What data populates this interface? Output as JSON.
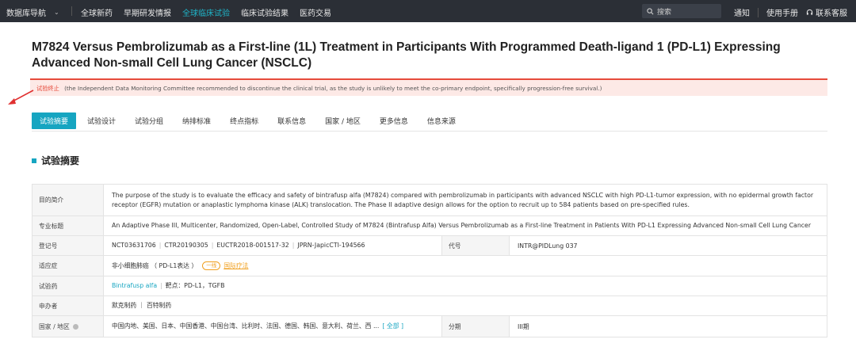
{
  "topnav": {
    "brand": "数据库导航",
    "links": [
      {
        "label": "全球新药",
        "active": false
      },
      {
        "label": "早期研发情报",
        "active": false
      },
      {
        "label": "全球临床试验",
        "active": true
      },
      {
        "label": "临床试验结果",
        "active": false
      },
      {
        "label": "医药交易",
        "active": false
      }
    ],
    "search_placeholder": "搜索",
    "notify": "通知",
    "manual": "使用手册",
    "support": "联系客服"
  },
  "title": "M7824 Versus Pembrolizumab as a First-line (1L) Treatment in Participants With Programmed Death-ligand 1 (PD-L1) Expressing Advanced Non-small Cell Lung Cancer (NSCLC)",
  "alert": {
    "status": "试验终止",
    "reason": "(the Independent Data Monitoring Committee recommended to discontinue the clinical trial, as the study is unlikely to meet the co-primary endpoint, specifically progression-free survival.)"
  },
  "tabs": [
    "试验摘要",
    "试验设计",
    "试验分组",
    "纳排标准",
    "终点指标",
    "联系信息",
    "国家 / 地区",
    "更多信息",
    "信息来源"
  ],
  "section_title": "试验摘要",
  "table": {
    "purpose_label": "目的简介",
    "purpose": "The purpose of the study is to evaluate the efficacy and safety of bintrafusp alfa (M7824) compared with pembrolizumab in participants with advanced NSCLC with high PD-L1-tumor expression, with no epidermal growth factor receptor (EGFR) mutation or anaplastic lymphoma kinase (ALK) translocation. The Phase II adaptive design allows for the option to recruit up to 584 patients based on pre-specified rules.",
    "official_title_label": "专业标题",
    "official_title": "An Adaptive Phase III, Multicenter, Randomized, Open-Label, Controlled Study of M7824 (Bintrafusp Alfa) Versus Pembrolizumab as a First-line Treatment in Patients With PD-L1 Expressing Advanced Non-small Cell Lung Cancer",
    "reg_label": "登记号",
    "reg_ids": [
      "NCT03631706",
      "CTR20190305",
      "EUCTR2018-001517-32",
      "JPRN-JapicCTI-194566"
    ],
    "code_label": "代号",
    "code": "INTR@PIDLung 037",
    "indication_label": "适应症",
    "indication": "非小细胞肺癌 （ PD-L1表达 ）",
    "indication_tag": "一线",
    "indication_link": "国际疗法",
    "drug_label": "试验药",
    "drug": "Bintrafusp alfa",
    "targets": "靶点：PD-L1，TGFB",
    "sponsor_label": "申办者",
    "sponsors": "默克制药 ｜ 百特制药",
    "country_label": "国家 / 地区",
    "countries": "中国内地、美国、日本、中国香港、中国台湾、比利时、法国、德国、韩国、意大利、荷兰、西 ...",
    "countries_all": "[ 全部 ]",
    "phase_label": "分期",
    "phase": "III期"
  }
}
